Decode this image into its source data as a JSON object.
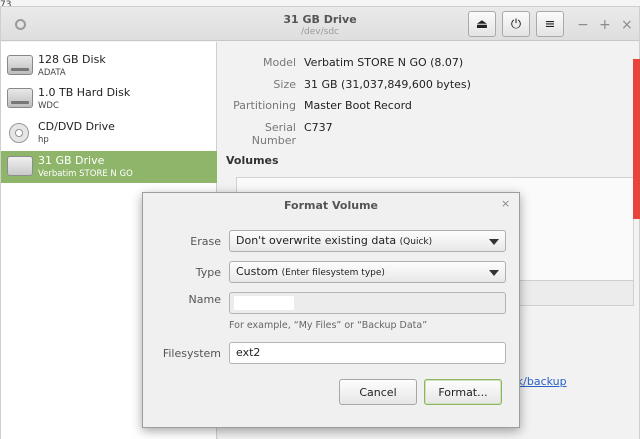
{
  "background": {
    "counter_text": "73"
  },
  "window": {
    "title": "31 GB Drive",
    "subtitle": "/dev/sdc",
    "controls": {
      "minimize": "−",
      "maximize": "+",
      "close": "×"
    }
  },
  "toolbar": {
    "eject_glyph": "⏏",
    "power_glyph": "⏻",
    "menu_glyph": "≡"
  },
  "sidebar": {
    "drives": [
      {
        "name": "128 GB Disk",
        "sub": "ADATA",
        "icon": "hard-disk-icon"
      },
      {
        "name": "1.0 TB Hard Disk",
        "sub": "WDC",
        "icon": "hard-disk-icon"
      },
      {
        "name": "CD/DVD Drive",
        "sub": "hp",
        "icon": "optical-disc-icon"
      },
      {
        "name": "31 GB Drive",
        "sub": "Verbatim STORE N GO",
        "icon": "usb-drive-icon",
        "selected": true
      }
    ]
  },
  "details": {
    "model_label": "Model",
    "model_value": "Verbatim STORE N GO (8.07)",
    "size_label": "Size",
    "size_value": "31 GB (31,037,849,600 bytes)",
    "partitioning_label": "Partitioning",
    "partitioning_value": "Master Boot Record",
    "serial_label": "Serial Number",
    "serial_value": "C737",
    "volumes_label": "Volumes",
    "link_fragment": "ek/backup"
  },
  "dialog": {
    "title": "Format Volume",
    "close_glyph": "×",
    "erase_label": "Erase",
    "erase_value": "Don't overwrite existing data",
    "erase_hint": "(Quick)",
    "type_label": "Type",
    "type_value": "Custom",
    "type_hint": "(Enter filesystem type)",
    "name_label": "Name",
    "name_value": "",
    "name_helper": "For example, “My Files” or “Backup Data”",
    "filesystem_label": "Filesystem",
    "filesystem_value": "ext2",
    "cancel_label": "Cancel",
    "format_label": "Format..."
  },
  "colors": {
    "selection": "#8fb56a",
    "link": "#2a61c7",
    "accent_red": "#e7443b"
  }
}
